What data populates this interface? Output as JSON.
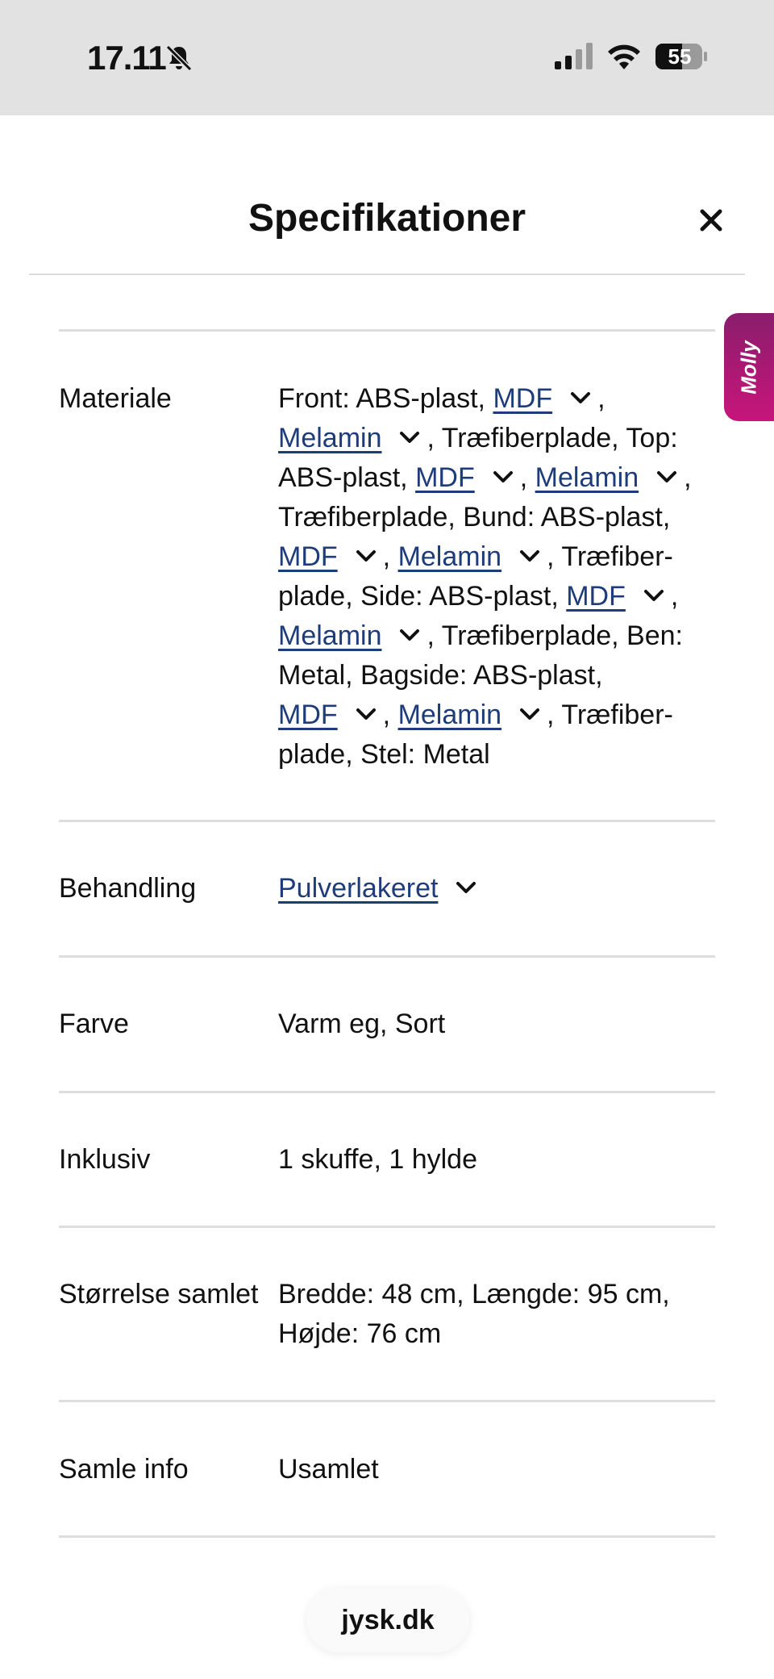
{
  "status_bar": {
    "time": "17.11",
    "battery": "55"
  },
  "modal": {
    "title": "Specifikationer"
  },
  "molly": {
    "label": "Molly"
  },
  "specs": {
    "material": {
      "label": "Materiale",
      "t1": "Front: ABS-plast,",
      "l1": "MDF",
      "t2": ",",
      "l2": "Melamin",
      "t3": ", Træfiberplade, Top:",
      "t4": "ABS-plast,",
      "l3": "MDF",
      "t5": ",",
      "l4": "Melamin",
      "t6": ",",
      "t7": "Træfiberplade, Bund: ABS-plast,",
      "l5": "MDF",
      "t8": ",",
      "l6": "Melamin",
      "t9": ", Træfiber-",
      "t10": "plade, Side: ABS-plast,",
      "l7": "MDF",
      "t11": ",",
      "l8": "Melamin",
      "t12": ", Træfiberplade, Ben:",
      "t13": "Metal, Bagside: ABS-plast,",
      "l9": "MDF",
      "t14": ",",
      "l10": "Melamin",
      "t15": ", Træfiber-",
      "t16": "plade, Stel: Metal"
    },
    "treatment": {
      "label": "Behandling",
      "value": "Pulverlakeret"
    },
    "color": {
      "label": "Farve",
      "value": "Varm eg, Sort"
    },
    "inclusive": {
      "label": "Inklusiv",
      "value": "1 skuffe, 1 hylde"
    },
    "size": {
      "label": "Størrelse samlet",
      "line1": "Bredde: 48 cm, Længde: 95 cm,",
      "line2": "Højde: 76 cm"
    },
    "assembly": {
      "label": "Samle info",
      "value": "Usamlet"
    }
  },
  "browser": {
    "url": "jysk.dk"
  }
}
